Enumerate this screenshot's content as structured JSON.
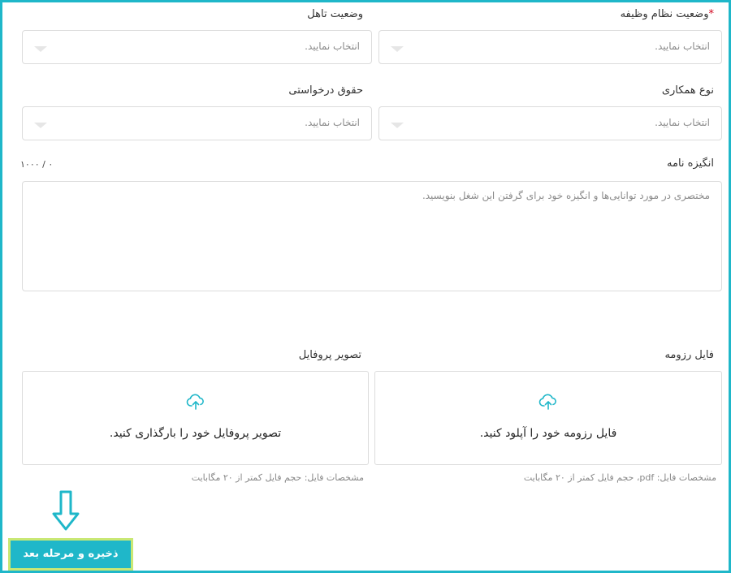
{
  "fields": {
    "job_status": {
      "label": "وضعیت نظام وظیفه",
      "required_mark": "*",
      "placeholder": "انتخاب نمایید."
    },
    "marital_status": {
      "label": "وضعیت تاهل",
      "placeholder": "انتخاب نمایید."
    },
    "cooperation_type": {
      "label": "نوع همکاری",
      "placeholder": "انتخاب نمایید."
    },
    "requested_salary": {
      "label": "حقوق درخواستی",
      "placeholder": "انتخاب نمایید."
    }
  },
  "motivation": {
    "label": "انگیزه نامه",
    "counter": "۰ / ۱۰۰۰",
    "placeholder": "مختصری در مورد توانایی‌ها و انگیزه خود برای گرفتن این شغل بنویسید."
  },
  "uploads": {
    "resume": {
      "label": "فایل رزومه",
      "text": "فایل رزومه خود را آپلود کنید.",
      "note": "مشخصات فایل: pdf، حجم فایل کمتر از ۲۰ مگابایت"
    },
    "profile": {
      "label": "تصویر پروفایل",
      "text": "تصویر پروفایل خود را بارگذاری کنید.",
      "note": "مشخصات فایل: حجم فایل کمتر از ۲۰ مگابایت"
    }
  },
  "save_button": "ذخیره و مرحله بعد",
  "icons": {
    "upload": "cloud-upload-icon",
    "caret": "chevron-down-icon",
    "arrow": "arrow-down-icon"
  },
  "colors": {
    "accent": "#1fb7c9",
    "button_border": "#c9e874",
    "required": "#d0021b"
  }
}
